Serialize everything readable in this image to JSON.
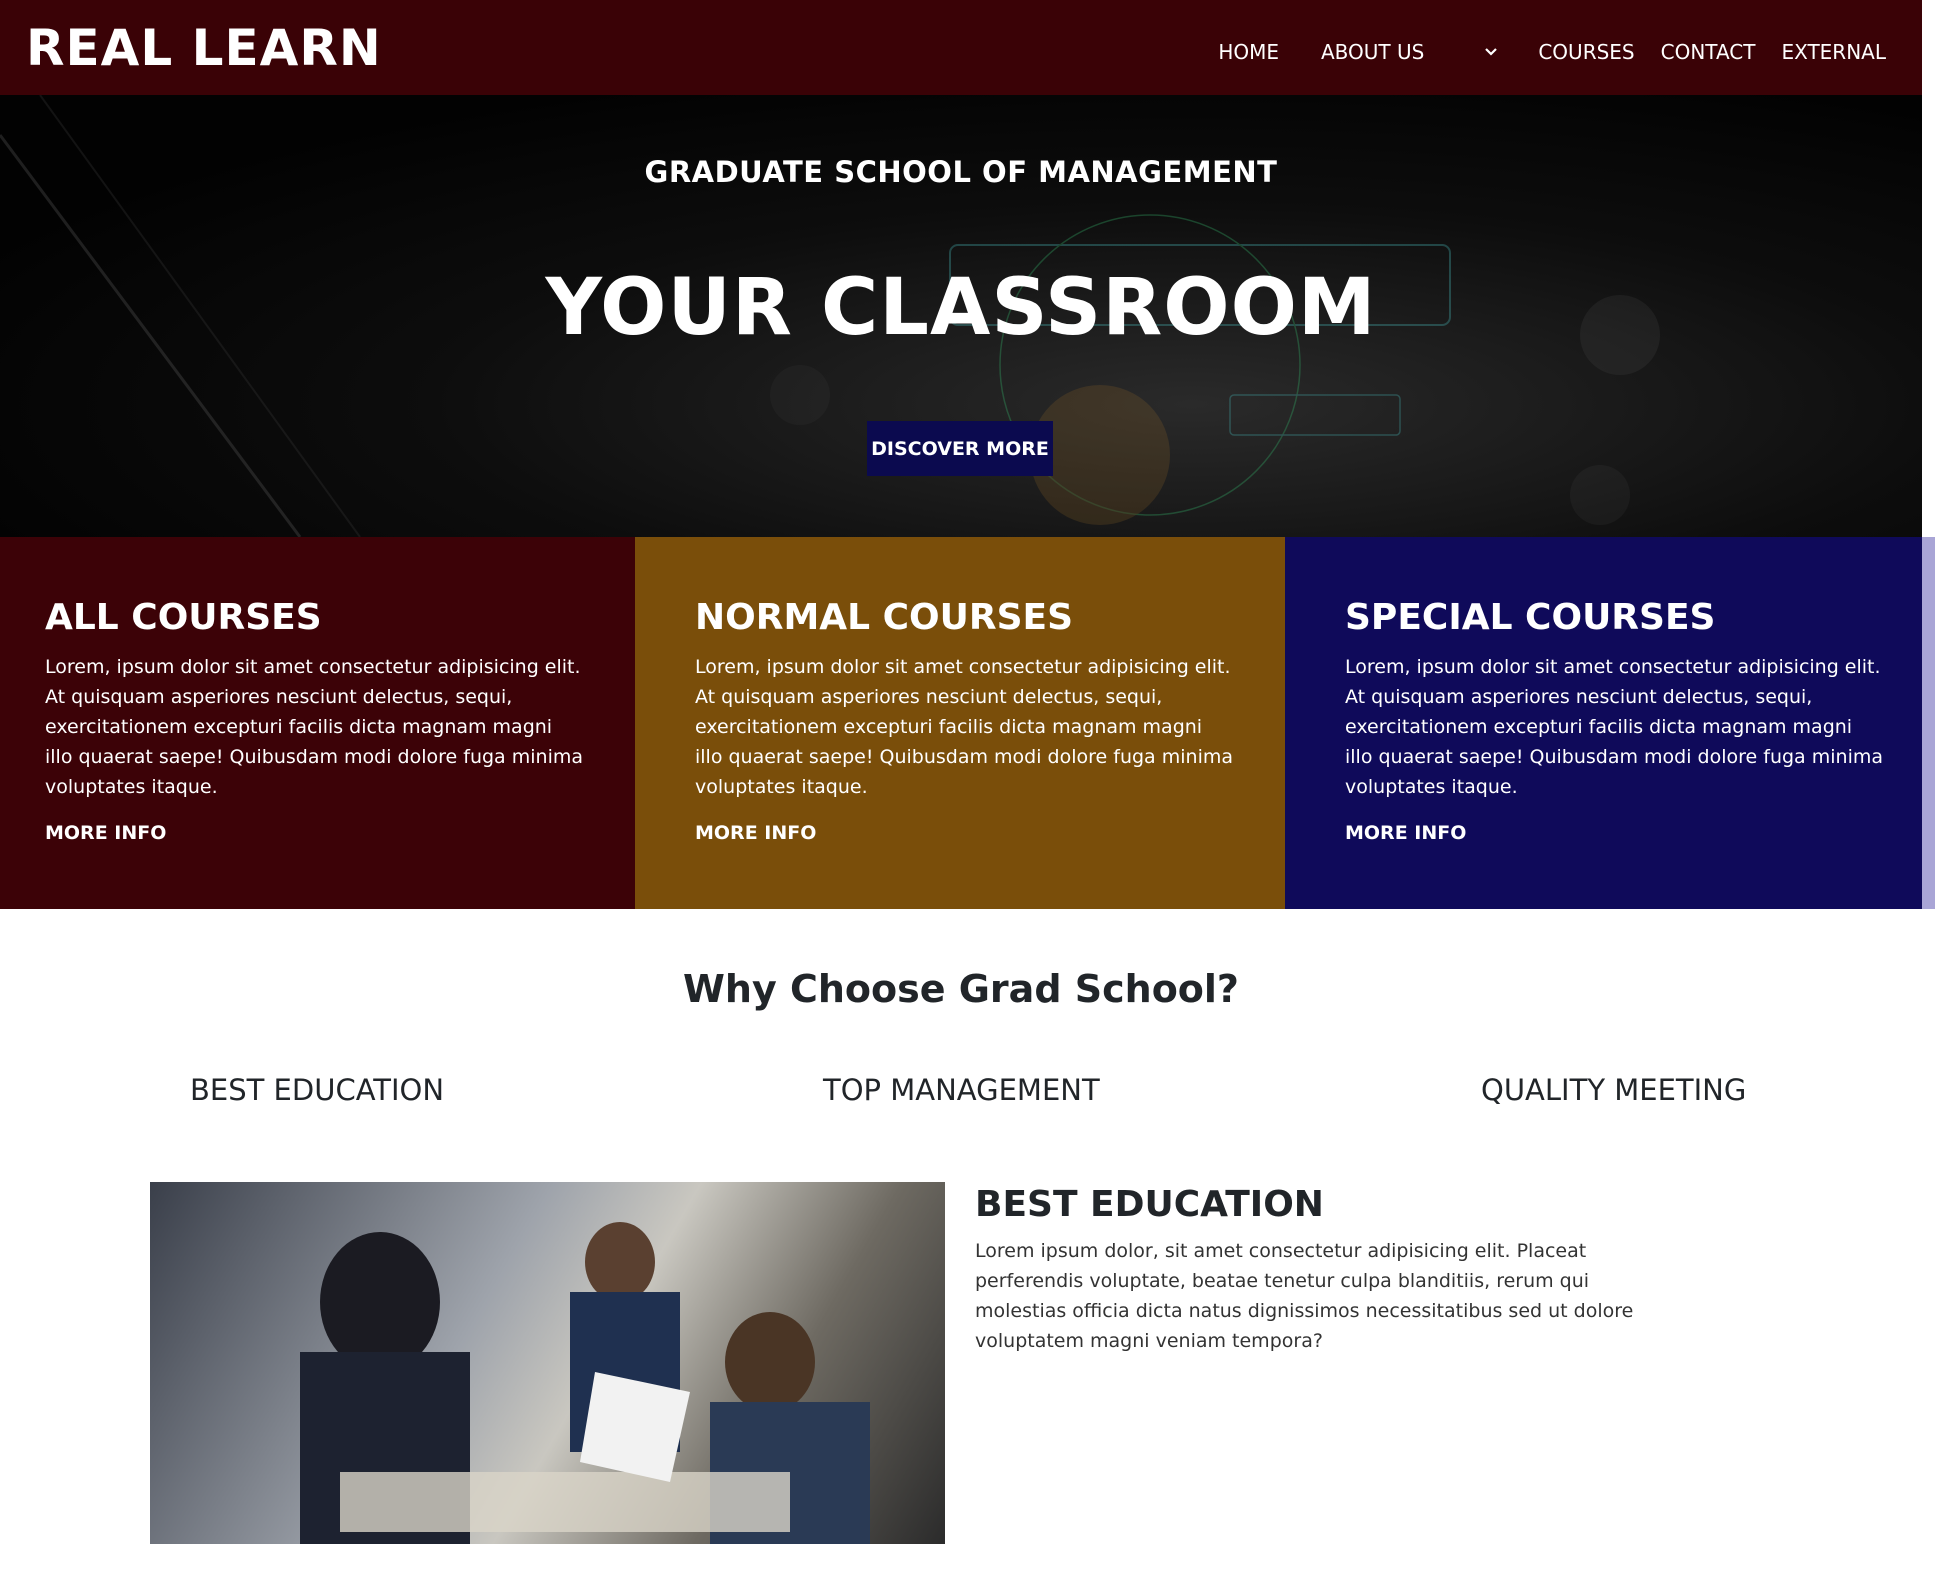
{
  "navbar": {
    "brand": "REAL LEARN",
    "items": [
      "HOME",
      "ABOUT US",
      "COURSES",
      "CONTACT",
      "EXTERNAL"
    ],
    "dropdown_icon": "chevron-down-icon"
  },
  "hero": {
    "subtitle": "GRADUATE SCHOOL OF MANAGEMENT",
    "title": "YOUR CLASSROOM",
    "button": "DISCOVER MORE"
  },
  "features": [
    {
      "title": "ALL COURSES",
      "text": "Lorem, ipsum dolor sit amet consectetur adipisicing elit. At quisquam asperiores nesciunt delectus, sequi, exercitationem excepturi facilis dicta magnam magni illo quaerat saepe! Quibusdam modi dolore fuga minima voluptates itaque.",
      "link": "MORE INFO",
      "color": "#3c0207"
    },
    {
      "title": "NORMAL COURSES",
      "text": "Lorem, ipsum dolor sit amet consectetur adipisicing elit. At quisquam asperiores nesciunt delectus, sequi, exercitationem excepturi facilis dicta magnam magni illo quaerat saepe! Quibusdam modi dolore fuga minima voluptates itaque.",
      "link": "MORE INFO",
      "color": "#7a4e0a"
    },
    {
      "title": "SPECIAL COURSES",
      "text": "Lorem, ipsum dolor sit amet consectetur adipisicing elit. At quisquam asperiores nesciunt delectus, sequi, exercitationem excepturi facilis dicta magnam magni illo quaerat saepe! Quibusdam modi dolore fuga minima voluptates itaque.",
      "link": "MORE INFO",
      "color": "#0f0a5a"
    }
  ],
  "why": {
    "title": "Why Choose Grad School?",
    "tabs": [
      "BEST EDUCATION",
      "TOP MANAGEMENT",
      "QUALITY MEETING"
    ]
  },
  "content": {
    "heading": "BEST EDUCATION",
    "text": "Lorem ipsum dolor, sit amet consectetur adipisicing elit. Placeat perferendis voluptate, beatae tenetur culpa blanditiis, rerum qui molestias officia dicta natus dignissimos necessitatibus sed ut dolore voluptatem magni veniam tempora?"
  },
  "colors": {
    "navbar": "#3a0206",
    "button": "#0b0a4f"
  }
}
